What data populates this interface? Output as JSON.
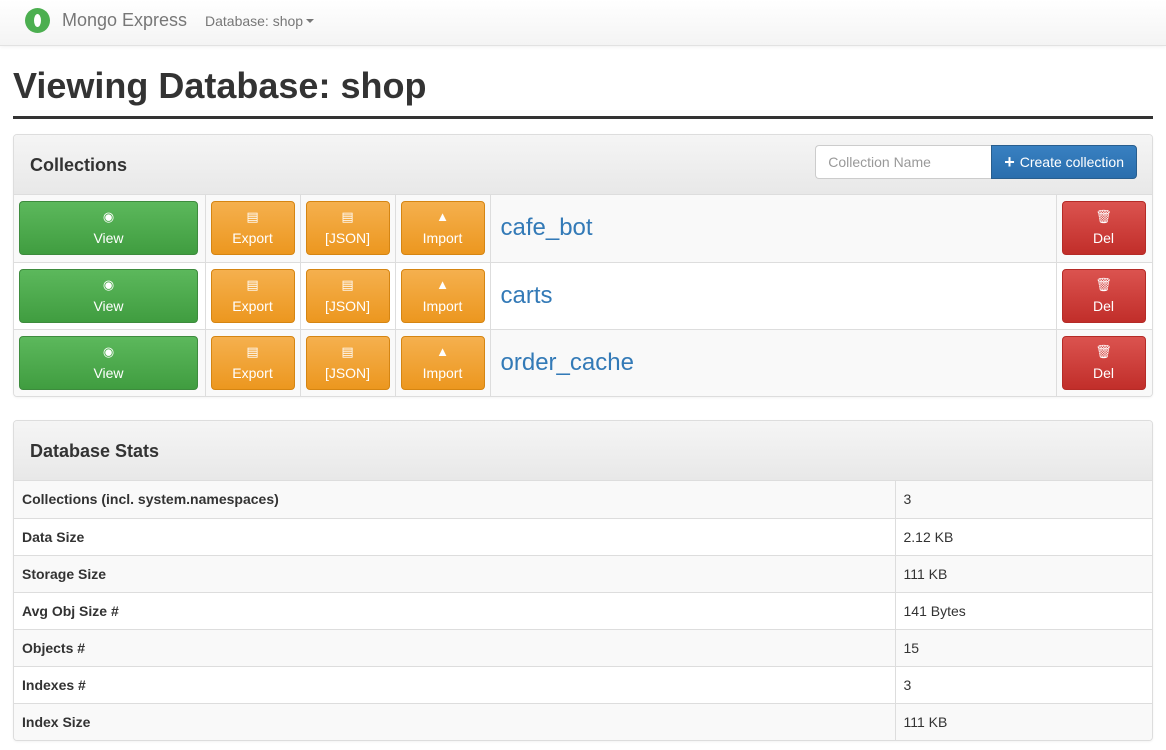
{
  "navbar": {
    "brand": "Mongo Express",
    "database_dropdown": "Database: shop"
  },
  "page_title": "Viewing Database: shop",
  "collections_panel": {
    "title": "Collections",
    "name_placeholder": "Collection Name",
    "create_label": "Create collection",
    "actions": {
      "view": "View",
      "export": "Export",
      "json": "[JSON]",
      "import": "Import",
      "delete": "Del"
    },
    "collections": [
      "cafe_bot",
      "carts",
      "order_cache"
    ]
  },
  "stats_panel": {
    "title": "Database Stats",
    "rows": [
      {
        "label": "Collections (incl. system.namespaces)",
        "value": "3"
      },
      {
        "label": "Data Size",
        "value": "2.12 KB"
      },
      {
        "label": "Storage Size",
        "value": "111 KB"
      },
      {
        "label": "Avg Obj Size #",
        "value": "141 Bytes"
      },
      {
        "label": "Objects #",
        "value": "15"
      },
      {
        "label": "Indexes #",
        "value": "3"
      },
      {
        "label": "Index Size",
        "value": "111 KB"
      }
    ]
  },
  "icons": {
    "brand": "mongodb-leaf-icon",
    "view": "eye-icon",
    "export": "save-download-icon",
    "json": "save-download-icon",
    "import": "cloud-upload-icon",
    "delete": "trash-icon",
    "create": "plus-icon"
  },
  "colors": {
    "view": "#5cb85c",
    "export": "#f0ad4e",
    "delete": "#d9534f",
    "create": "#337ab7",
    "link": "#337ab7",
    "brand_leaf": "#4caf50"
  }
}
